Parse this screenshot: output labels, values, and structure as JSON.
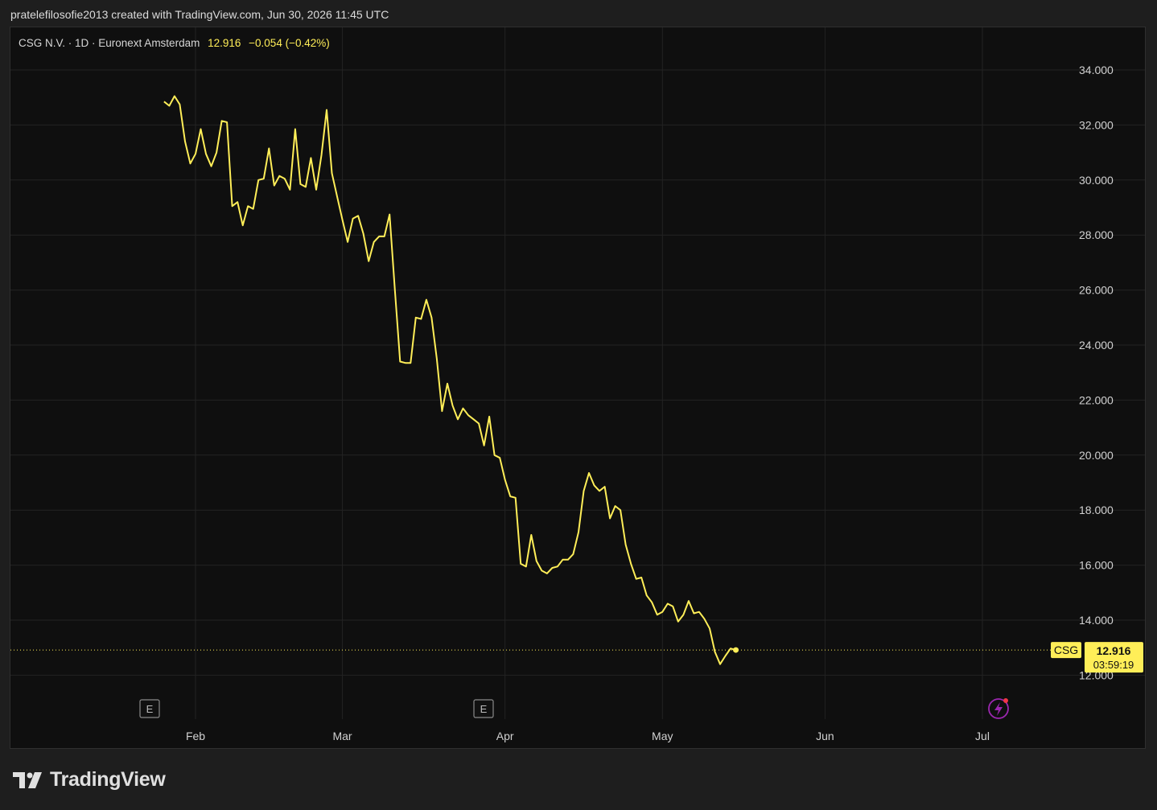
{
  "caption": "pratelefilosofie2013 created with TradingView.com, Jun 30, 2026 11:45 UTC",
  "legend": {
    "symbol_info": "CSG N.V. · 1D · Euronext Amsterdam",
    "last": "12.916",
    "change": "−0.054 (−0.42%)"
  },
  "brand": "TradingView",
  "colors": {
    "line": "#ffee58",
    "background": "#0f0f0f",
    "grid": "#232323",
    "axis_text": "#d1d1d1"
  },
  "chart_data": {
    "type": "line",
    "title": "CSG N.V. · 1D · Euronext Amsterdam",
    "ylim": [
      11.3,
      34.8
    ],
    "y_ticks": [
      "34.000",
      "32.000",
      "30.000",
      "28.000",
      "26.000",
      "24.000",
      "22.000",
      "20.000",
      "18.000",
      "16.000",
      "14.000",
      "12.000"
    ],
    "x_ticks": [
      {
        "label": "Feb",
        "date": "2026-02-01"
      },
      {
        "label": "Mar",
        "date": "2026-03-01"
      },
      {
        "label": "Apr",
        "date": "2026-04-01"
      },
      {
        "label": "May",
        "date": "2026-05-01"
      },
      {
        "label": "Jun",
        "date": "2026-06-01"
      },
      {
        "label": "Jul",
        "date": "2026-07-01"
      }
    ],
    "grid": true,
    "series": [
      {
        "name": "CSG",
        "points": [
          [
            "2026-01-26",
            32.85
          ],
          [
            "2026-01-27",
            32.7
          ],
          [
            "2026-01-28",
            33.05
          ],
          [
            "2026-01-29",
            32.75
          ],
          [
            "2026-01-30",
            31.4
          ],
          [
            "2026-01-31",
            30.6
          ],
          [
            "2026-02-01",
            30.95
          ],
          [
            "2026-02-02",
            31.85
          ],
          [
            "2026-02-03",
            30.95
          ],
          [
            "2026-02-04",
            30.5
          ],
          [
            "2026-02-05",
            31.0
          ],
          [
            "2026-02-06",
            32.15
          ],
          [
            "2026-02-07",
            32.1
          ],
          [
            "2026-02-08",
            29.05
          ],
          [
            "2026-02-09",
            29.2
          ],
          [
            "2026-02-10",
            28.35
          ],
          [
            "2026-02-11",
            29.05
          ],
          [
            "2026-02-12",
            28.95
          ],
          [
            "2026-02-13",
            30.0
          ],
          [
            "2026-02-14",
            30.05
          ],
          [
            "2026-02-15",
            31.15
          ],
          [
            "2026-02-16",
            29.8
          ],
          [
            "2026-02-17",
            30.15
          ],
          [
            "2026-02-18",
            30.05
          ],
          [
            "2026-02-19",
            29.65
          ],
          [
            "2026-02-20",
            31.85
          ],
          [
            "2026-02-21",
            29.85
          ],
          [
            "2026-02-22",
            29.75
          ],
          [
            "2026-02-23",
            30.8
          ],
          [
            "2026-02-24",
            29.65
          ],
          [
            "2026-02-25",
            30.9
          ],
          [
            "2026-02-26",
            32.55
          ],
          [
            "2026-02-27",
            30.25
          ],
          [
            "2026-02-28",
            29.4
          ],
          [
            "2026-03-01",
            28.55
          ],
          [
            "2026-03-02",
            27.75
          ],
          [
            "2026-03-03",
            28.6
          ],
          [
            "2026-03-04",
            28.7
          ],
          [
            "2026-03-05",
            28.05
          ],
          [
            "2026-03-06",
            27.05
          ],
          [
            "2026-03-07",
            27.75
          ],
          [
            "2026-03-08",
            27.95
          ],
          [
            "2026-03-09",
            27.95
          ],
          [
            "2026-03-10",
            28.75
          ],
          [
            "2026-03-11",
            26.0
          ],
          [
            "2026-03-12",
            23.4
          ],
          [
            "2026-03-13",
            23.35
          ],
          [
            "2026-03-14",
            23.35
          ],
          [
            "2026-03-15",
            25.0
          ],
          [
            "2026-03-16",
            24.95
          ],
          [
            "2026-03-17",
            25.65
          ],
          [
            "2026-03-18",
            25.0
          ],
          [
            "2026-03-19",
            23.5
          ],
          [
            "2026-03-20",
            21.6
          ],
          [
            "2026-03-21",
            22.6
          ],
          [
            "2026-03-22",
            21.8
          ],
          [
            "2026-03-23",
            21.3
          ],
          [
            "2026-03-24",
            21.7
          ],
          [
            "2026-03-25",
            21.45
          ],
          [
            "2026-03-26",
            21.3
          ],
          [
            "2026-03-27",
            21.15
          ],
          [
            "2026-03-28",
            20.35
          ],
          [
            "2026-03-29",
            21.4
          ],
          [
            "2026-03-30",
            20.0
          ],
          [
            "2026-03-31",
            19.9
          ],
          [
            "2026-04-01",
            19.1
          ],
          [
            "2026-04-02",
            18.5
          ],
          [
            "2026-04-03",
            18.45
          ],
          [
            "2026-04-04",
            16.05
          ],
          [
            "2026-04-05",
            15.95
          ],
          [
            "2026-04-06",
            17.1
          ],
          [
            "2026-04-07",
            16.15
          ],
          [
            "2026-04-08",
            15.8
          ],
          [
            "2026-04-09",
            15.7
          ],
          [
            "2026-04-10",
            15.9
          ],
          [
            "2026-04-11",
            15.95
          ],
          [
            "2026-04-12",
            16.2
          ],
          [
            "2026-04-13",
            16.2
          ],
          [
            "2026-04-14",
            16.4
          ],
          [
            "2026-04-15",
            17.2
          ],
          [
            "2026-04-16",
            18.7
          ],
          [
            "2026-04-17",
            19.35
          ],
          [
            "2026-04-18",
            18.9
          ],
          [
            "2026-04-19",
            18.7
          ],
          [
            "2026-04-20",
            18.85
          ],
          [
            "2026-04-21",
            17.7
          ],
          [
            "2026-04-22",
            18.15
          ],
          [
            "2026-04-23",
            18.0
          ],
          [
            "2026-04-24",
            16.75
          ],
          [
            "2026-04-25",
            16.05
          ],
          [
            "2026-04-26",
            15.5
          ],
          [
            "2026-04-27",
            15.55
          ],
          [
            "2026-04-28",
            14.9
          ],
          [
            "2026-04-29",
            14.65
          ],
          [
            "2026-04-30",
            14.2
          ],
          [
            "2026-05-01",
            14.3
          ],
          [
            "2026-05-02",
            14.6
          ],
          [
            "2026-05-03",
            14.5
          ],
          [
            "2026-05-04",
            13.95
          ],
          [
            "2026-05-05",
            14.2
          ],
          [
            "2026-05-06",
            14.7
          ],
          [
            "2026-05-07",
            14.25
          ],
          [
            "2026-05-08",
            14.3
          ],
          [
            "2026-05-09",
            14.05
          ],
          [
            "2026-05-10",
            13.7
          ],
          [
            "2026-05-11",
            12.85
          ],
          [
            "2026-05-12",
            12.4
          ],
          [
            "2026-05-13",
            12.7
          ],
          [
            "2026-05-14",
            12.97
          ],
          [
            "2026-05-15",
            12.916
          ]
        ]
      }
    ],
    "events": [
      "E",
      "E"
    ],
    "price_label": {
      "symbol": "CSG",
      "value": "12.916",
      "countdown": "03:59:19",
      "y": 12.916
    }
  }
}
